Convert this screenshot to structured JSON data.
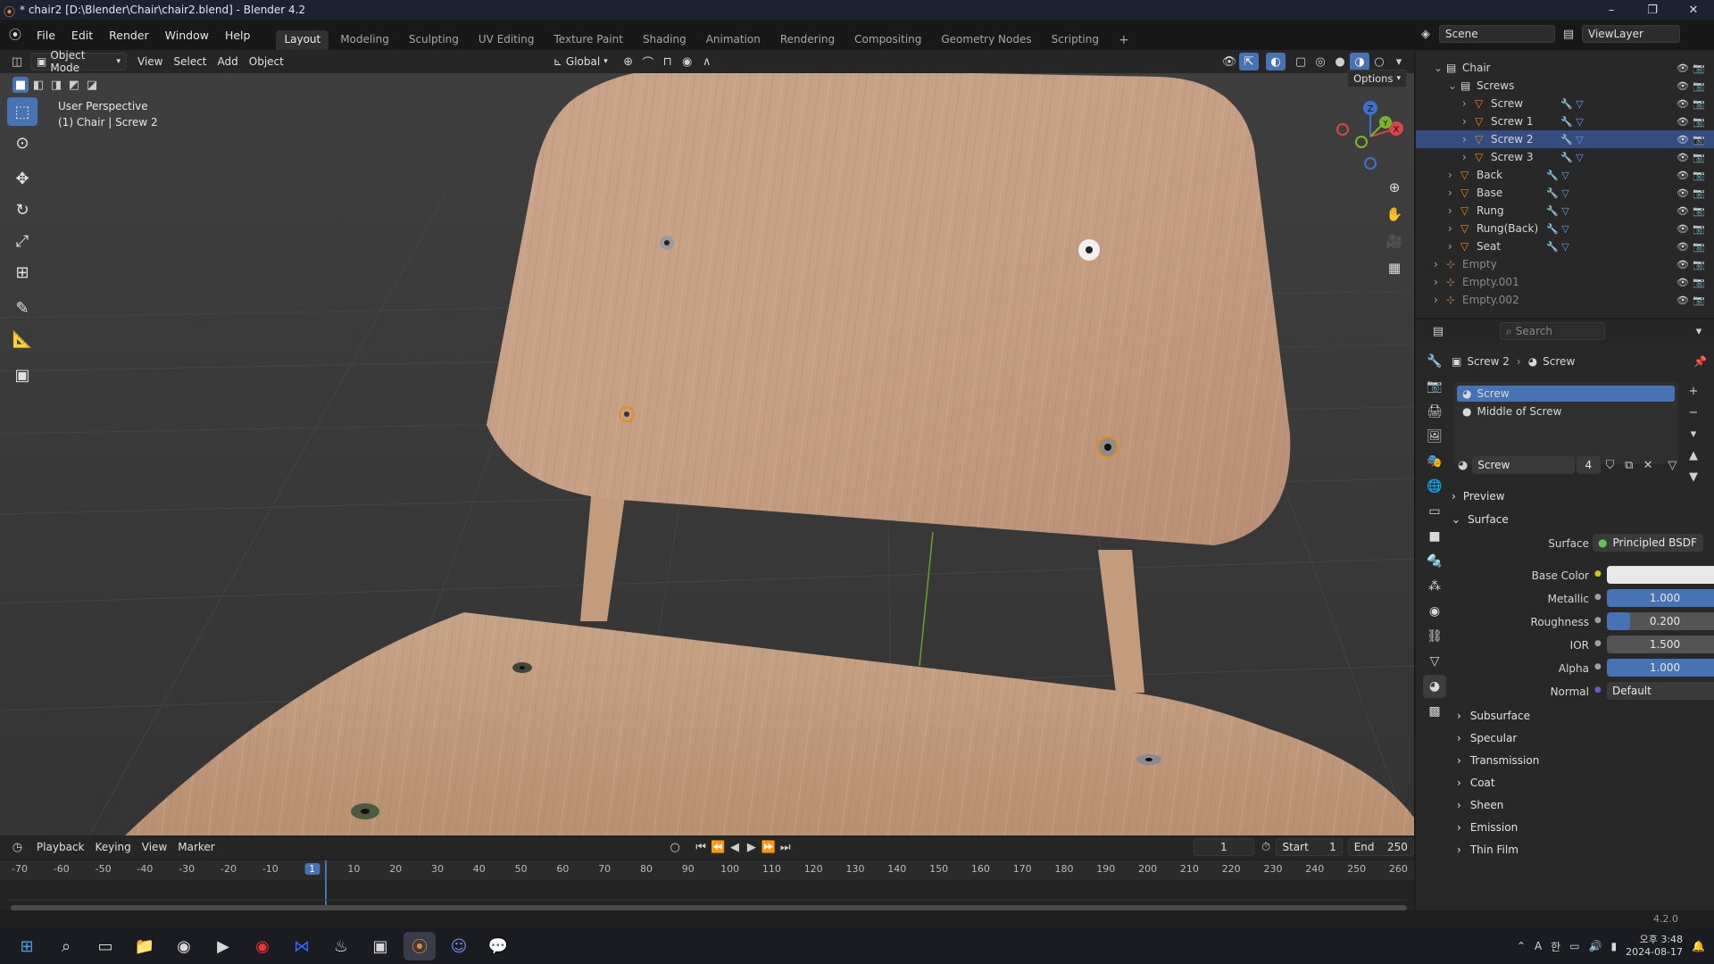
{
  "window": {
    "title": "* chair2 [D:\\Blender\\Chair\\chair2.blend] - Blender 4.2",
    "minimize": "–",
    "maximize": "❐",
    "close": "✕"
  },
  "menus": [
    "File",
    "Edit",
    "Render",
    "Window",
    "Help"
  ],
  "workspaces": [
    "Layout",
    "Modeling",
    "Sculpting",
    "UV Editing",
    "Texture Paint",
    "Shading",
    "Animation",
    "Rendering",
    "Compositing",
    "Geometry Nodes",
    "Scripting"
  ],
  "active_workspace": "Layout",
  "scene_name": "Scene",
  "view_layer": "ViewLayer",
  "viewport": {
    "mode": "Object Mode",
    "menus": [
      "View",
      "Select",
      "Add",
      "Object"
    ],
    "orientation": "Global",
    "options": "Options",
    "perspective_label": "User Perspective",
    "object_label": "(1) Chair | Screw 2",
    "gizmo_axes": {
      "z": "Z",
      "y": "Y",
      "x": "X"
    }
  },
  "timeline": {
    "menus": [
      "Playback",
      "Keying",
      "View",
      "Marker"
    ],
    "current_frame": "1",
    "start_label": "Start",
    "start": "1",
    "end_label": "End",
    "end": "250",
    "ruler": [
      "-70",
      "-60",
      "-50",
      "-40",
      "-30",
      "-20",
      "-10",
      "1",
      "10",
      "20",
      "30",
      "40",
      "50",
      "60",
      "70",
      "80",
      "90",
      "100",
      "110",
      "120",
      "130",
      "140",
      "150",
      "160",
      "170",
      "180",
      "190",
      "200",
      "210",
      "220",
      "230",
      "240",
      "250",
      "260"
    ]
  },
  "outliner": {
    "search_placeholder": "Search",
    "rows": [
      {
        "label": "Chair",
        "level": 0,
        "type": "collection"
      },
      {
        "label": "Screws",
        "level": 1,
        "type": "collection"
      },
      {
        "label": "Screw",
        "level": 2,
        "type": "mesh"
      },
      {
        "label": "Screw 1",
        "level": 2,
        "type": "mesh"
      },
      {
        "label": "Screw 2",
        "level": 2,
        "type": "mesh",
        "selected": true
      },
      {
        "label": "Screw 3",
        "level": 2,
        "type": "mesh"
      },
      {
        "label": "Back",
        "level": 1,
        "type": "mesh"
      },
      {
        "label": "Base",
        "level": 1,
        "type": "mesh"
      },
      {
        "label": "Rung",
        "level": 1,
        "type": "mesh"
      },
      {
        "label": "Rung(Back)",
        "level": 1,
        "type": "mesh"
      },
      {
        "label": "Seat",
        "level": 1,
        "type": "mesh"
      },
      {
        "label": "Empty",
        "level": 0,
        "type": "empty"
      },
      {
        "label": "Empty.001",
        "level": 0,
        "type": "empty"
      },
      {
        "label": "Empty.002",
        "level": 0,
        "type": "empty"
      }
    ]
  },
  "properties": {
    "search_placeholder": "Search",
    "breadcrumb_object": "Screw 2",
    "breadcrumb_material": "Screw",
    "material_slots": [
      "Screw",
      "Middle of Screw"
    ],
    "material_name": "Screw",
    "material_users": "4",
    "panels": {
      "preview": "Preview",
      "surface": "Surface"
    },
    "surface_label": "Surface",
    "surface_value": "Principled BSDF",
    "inputs": [
      {
        "label": "Base Color",
        "value": "",
        "kind": "color",
        "fill": 0
      },
      {
        "label": "Metallic",
        "value": "1.000",
        "kind": "slider",
        "fill": 1.0
      },
      {
        "label": "Roughness",
        "value": "0.200",
        "kind": "slider",
        "fill": 0.2
      },
      {
        "label": "IOR",
        "value": "1.500",
        "kind": "slider",
        "fill": 0
      },
      {
        "label": "Alpha",
        "value": "1.000",
        "kind": "slider",
        "fill": 1.0
      },
      {
        "label": "Normal",
        "value": "Default",
        "kind": "link",
        "fill": 0
      }
    ],
    "subpanels": [
      "Subsurface",
      "Specular",
      "Transmission",
      "Coat",
      "Sheen",
      "Emission",
      "Thin Film"
    ]
  },
  "status": {
    "version": "4.2.0"
  },
  "taskbar": {
    "time": "오후 3:48",
    "date": "2024-08-17",
    "ime": "A",
    "ime2": "한"
  },
  "colors": {
    "accent": "#4772b3",
    "wood": "#c9a27f",
    "selected_row": "#334d80",
    "orange": "#e58a1f"
  }
}
